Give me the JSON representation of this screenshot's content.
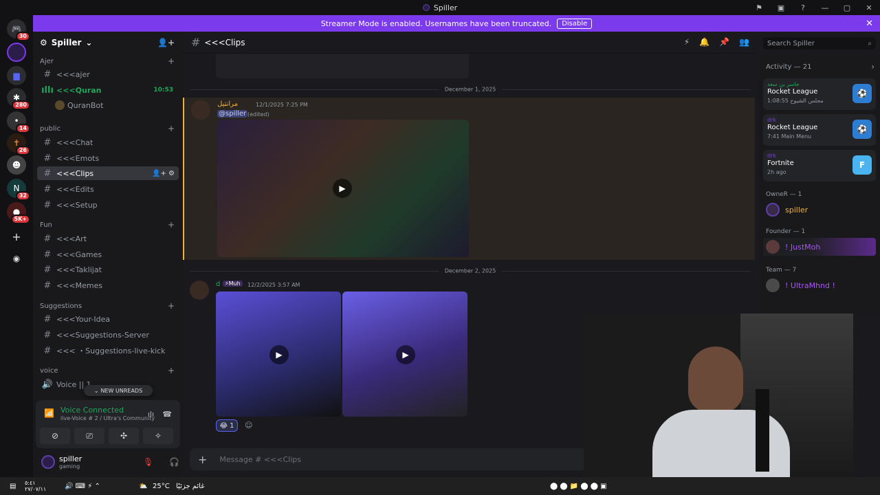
{
  "window": {
    "title": "Spiller"
  },
  "banner": {
    "text": "Streamer Mode is enabled. Usernames have been truncated.",
    "button": "Disable",
    "close": "✕"
  },
  "guilds": [
    {
      "badge": "30"
    },
    {
      "badge": ""
    },
    {
      "badge": "280"
    },
    {
      "badge": "14"
    },
    {
      "badge": "26"
    },
    {
      "badge": ""
    },
    {
      "badge": "32"
    },
    {
      "badge": "5K+"
    }
  ],
  "server": {
    "name": "Spiller"
  },
  "sidebar": {
    "categories": [
      {
        "name": "Ajer"
      },
      {
        "name": "public"
      },
      {
        "name": "Fun"
      },
      {
        "name": "Suggestions"
      },
      {
        "name": "voice"
      }
    ],
    "channels": [
      {
        "label": "<<<ajer"
      },
      {
        "label": "<<<Quran",
        "time": "10:53"
      },
      {
        "label": "QuranBot"
      },
      {
        "label": "<<<Chat"
      },
      {
        "label": "<<<Emots"
      },
      {
        "label": "<<<Clips"
      },
      {
        "label": "<<<Edits"
      },
      {
        "label": "<<<Setup"
      },
      {
        "label": "<<<Art"
      },
      {
        "label": "<<<Games"
      },
      {
        "label": "<<<Taklijat"
      },
      {
        "label": "<<<Memes"
      },
      {
        "label": "<<<Your-Idea"
      },
      {
        "label": "<<<Suggestions-Server"
      },
      {
        "label": "<<< ・Suggestions-live-kick"
      },
      {
        "label": "Voice || 1"
      }
    ],
    "new_unreads": "NEW UNREADS"
  },
  "voice": {
    "title": "Voice Connected",
    "sub": "live-Voice # 2 / Ultra's Community"
  },
  "user": {
    "name": "spiller",
    "status": "gaming"
  },
  "chat": {
    "channel": "<<<Clips",
    "date1": "December 1, 2025",
    "date2": "December 2, 2025",
    "msg1": {
      "user": "مرانتيل",
      "time": "12/1/2025 7:25 PM",
      "mention": "@spiller",
      "edited": "(edited)"
    },
    "msg2": {
      "user": "d",
      "tag": "Muh",
      "time": "12/2/2025 3:57 AM",
      "reaction_count": "1"
    },
    "composer_placeholder": "Message # <<<Clips"
  },
  "search": {
    "placeholder": "Search Spiller"
  },
  "members": {
    "activity_title": "Activity — 21",
    "activities": [
      {
        "who": "جاسر بن سعد",
        "game": "Rocket League",
        "detail": "1:08:55 مجلس الشيوخ"
      },
      {
        "who": "drk",
        "game": "Rocket League",
        "detail": "7:41 Main Menu"
      },
      {
        "who": "drk",
        "game": "Fortnite",
        "detail": "2h ago"
      }
    ],
    "roles": [
      {
        "name": "OwneR — 1",
        "member": "spiller"
      },
      {
        "name": "Founder — 1",
        "member": "! JustMoh"
      },
      {
        "name": "Team — 7",
        "member": "! UltraMhnd !"
      }
    ]
  },
  "taskbar": {
    "weather": "25°C",
    "weather_text": "غائم جزئيًا",
    "date": "٢٧/٠٧/١١",
    "time": "٥:٤١"
  }
}
